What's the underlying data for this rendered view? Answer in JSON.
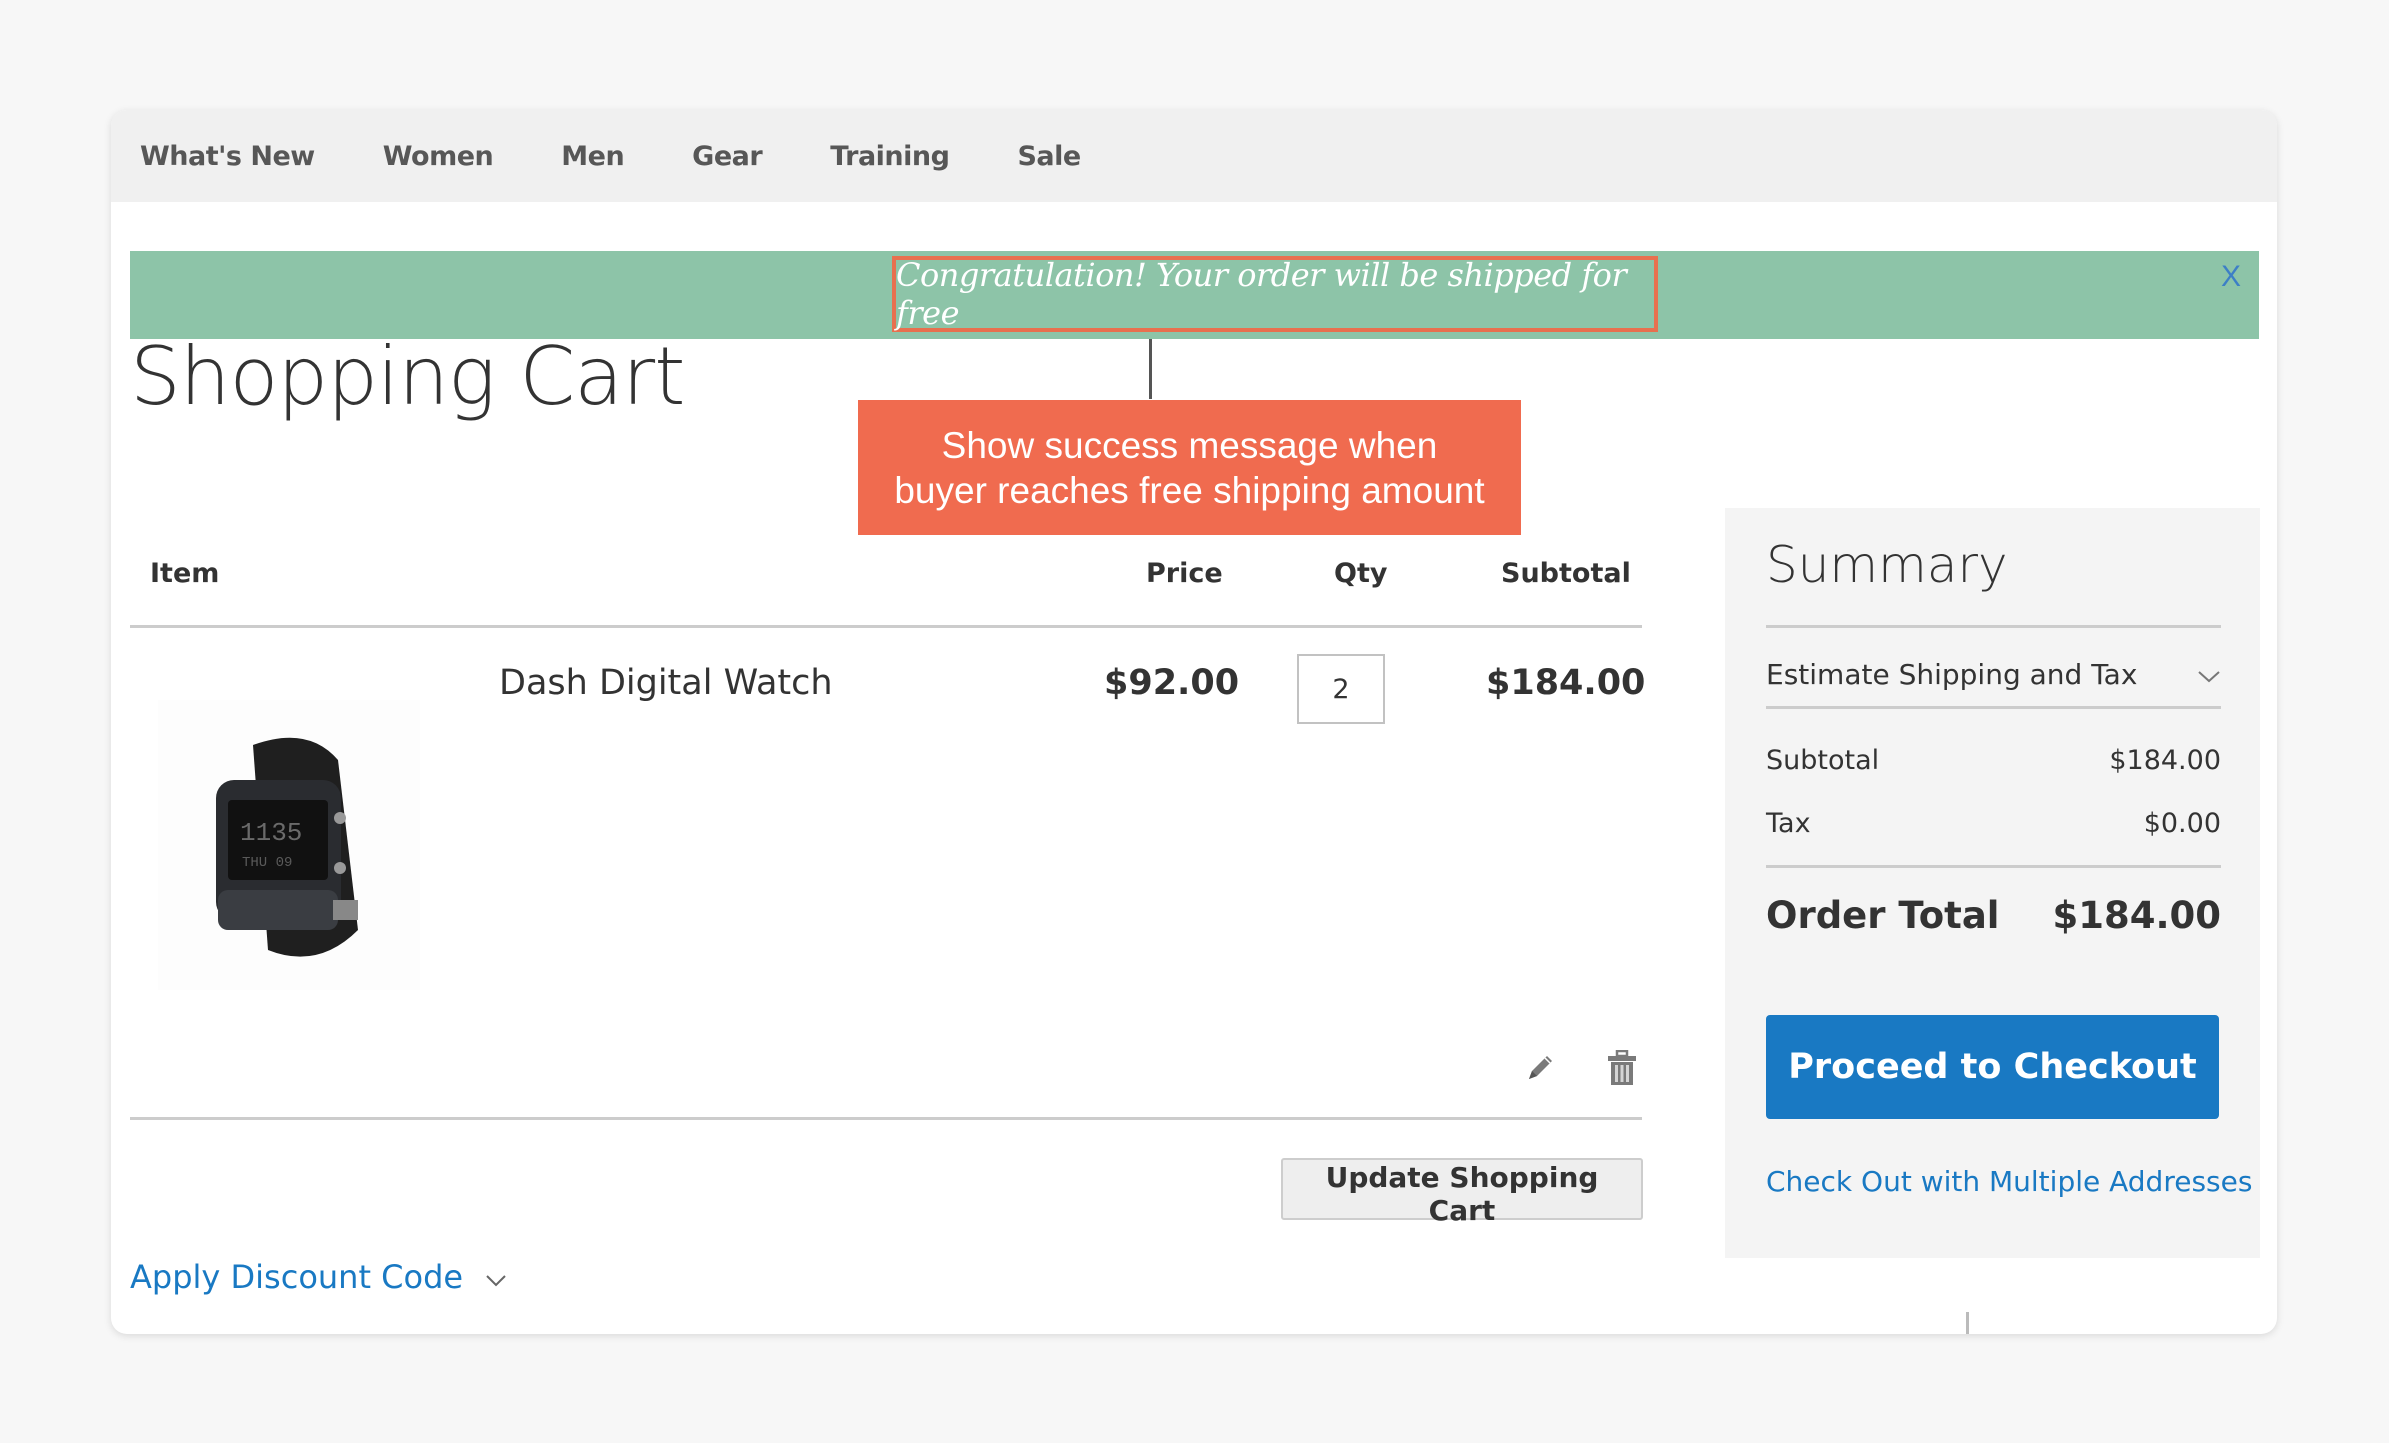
{
  "nav": {
    "items": [
      "What's New",
      "Women",
      "Men",
      "Gear",
      "Training",
      "Sale"
    ]
  },
  "banner": {
    "message": "Congratulation! Your order will be shipped for free",
    "close_label": "X",
    "background_color": "#8dc4a8"
  },
  "annotation": {
    "line1": "Show success message when",
    "line2": "buyer reaches free shipping amount",
    "color": "#f06b4f"
  },
  "page": {
    "title": "Shopping Cart"
  },
  "cart": {
    "headers": {
      "item": "Item",
      "price": "Price",
      "qty": "Qty",
      "subtotal": "Subtotal"
    },
    "items": [
      {
        "name": "Dash Digital Watch",
        "price": "$92.00",
        "qty": "2",
        "subtotal": "$184.00",
        "image_icon": "watch-image"
      }
    ],
    "edit_icon": "pencil-icon",
    "delete_icon": "trash-icon",
    "update_label": "Update Shopping Cart",
    "discount_label": "Apply Discount Code"
  },
  "summary": {
    "title": "Summary",
    "estimate_label": "Estimate Shipping and Tax",
    "rows": [
      {
        "label": "Subtotal",
        "value": "$184.00"
      },
      {
        "label": "Tax",
        "value": "$0.00"
      }
    ],
    "order_total_label": "Order Total",
    "order_total_value": "$184.00",
    "checkout_label": "Proceed to Checkout",
    "multi_address_label": "Check Out with Multiple Addresses",
    "accent_color": "#1979c3"
  }
}
